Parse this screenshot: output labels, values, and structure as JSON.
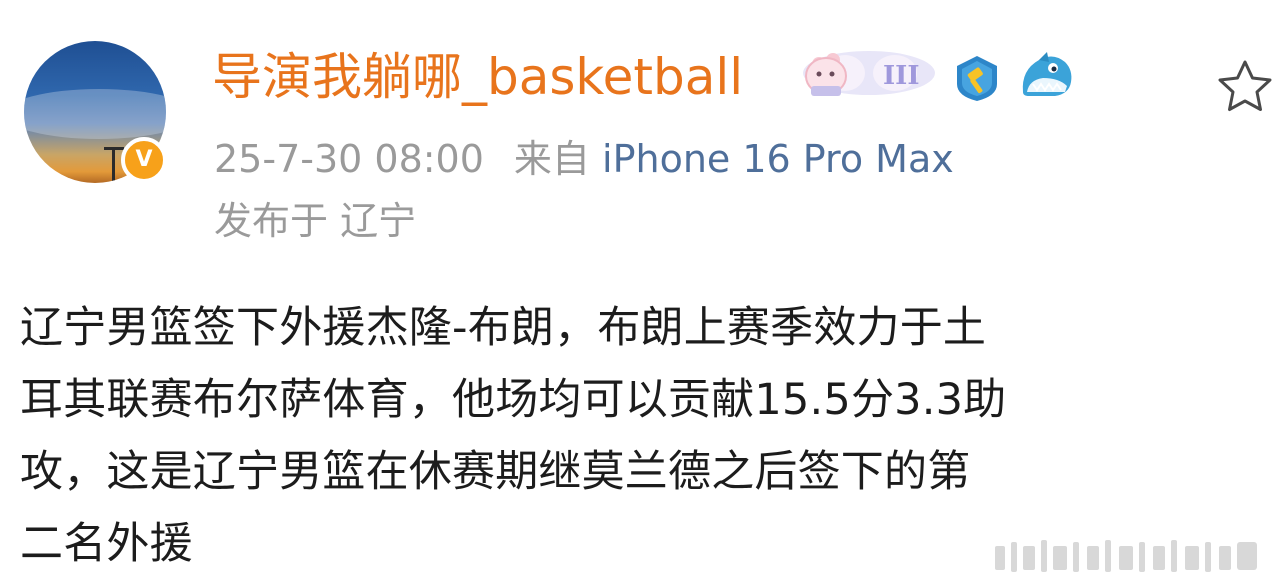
{
  "post": {
    "username": "导演我躺哪_basketball",
    "timestamp": "25-7-30 08:00",
    "source_prefix": "来自",
    "device": "iPhone 16 Pro Max",
    "location": "发布于 辽宁",
    "content_lines": [
      "辽宁男篮签下外援杰隆-布朗，布朗上赛季效力于土",
      "耳其联赛布尔萨体育，他场均可以贡献15.5分3.3助",
      "攻，这是辽宁男篮在休赛期继莫兰德之后签下的第",
      "二名外援"
    ],
    "medal_text": "III",
    "verified_badge_text": "V"
  },
  "icons": {
    "verified": "verified-badge-icon",
    "medal": "fan-level-medal-icon",
    "gold_badge": "gold-membership-badge-icon",
    "shark": "shark-sticker-icon",
    "star": "favorite-star-icon"
  },
  "colors": {
    "username": "#e8741c",
    "meta": "#9a9a9a",
    "device": "#4f6f9a",
    "body_text": "#1c1c1c",
    "verified_badge": "#f7a11a"
  }
}
